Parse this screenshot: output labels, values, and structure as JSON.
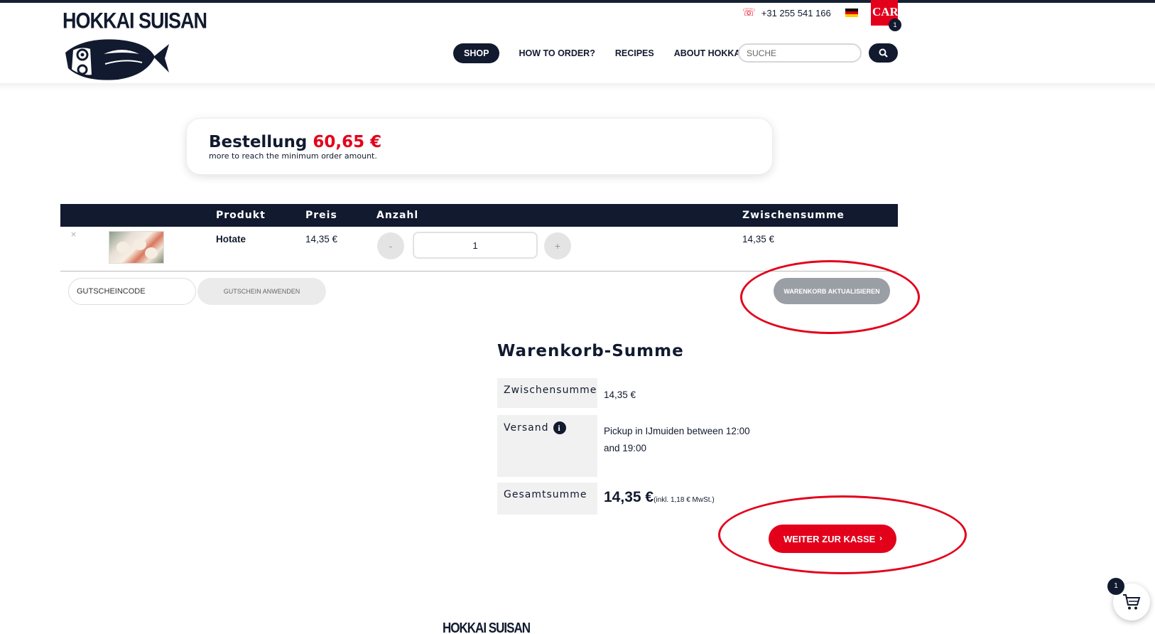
{
  "brand": {
    "name": "HOKKAI SUISAN"
  },
  "topbar": {
    "phone": "+31 255 541 166",
    "cart_label": "CART",
    "cart_count": "1"
  },
  "nav": {
    "items": [
      {
        "label": "SHOP",
        "active": true
      },
      {
        "label": "HOW TO ORDER?"
      },
      {
        "label": "RECIPES"
      },
      {
        "label": "ABOUT HOKKAI"
      }
    ],
    "search_placeholder": "SUCHE"
  },
  "notice": {
    "title": "Bestellung",
    "amount": "60,65 €",
    "subtitle": "more to reach the minimum order amount."
  },
  "cart_table": {
    "headers": {
      "product": "Produkt",
      "price": "Preis",
      "quantity": "Anzahl",
      "subtotal": "Zwischensumme"
    },
    "rows": [
      {
        "remove": "×",
        "name": "Hotate",
        "price": "14,35 €",
        "qty_minus": "-",
        "quantity": "1",
        "qty_plus": "+",
        "subtotal": "14,35 €"
      }
    ]
  },
  "coupon": {
    "placeholder": "GUTSCHEINCODE",
    "apply_label": "GUTSCHEIN ANWENDEN"
  },
  "update_cart_label": "WARENKORB AKTUALISIEREN",
  "totals": {
    "title": "Warenkorb-Summe",
    "subtotal_label": "Zwischensumme",
    "subtotal_value": "14,35 €",
    "shipping_label": "Versand",
    "shipping_value_line1": "Pickup in IJmuiden between 12:00",
    "shipping_value_line2": "and 19:00",
    "total_label": "Gesamtsumme",
    "total_value": "14,35 €",
    "tax_note": "(inkl. 1,18 € MwSt.)"
  },
  "checkout_label": "WEITER ZUR KASSE",
  "floating_cart_count": "1",
  "footer": {
    "logo_text": "HOKKAI SUISAN"
  },
  "colors": {
    "navy": "#111a2e",
    "red": "#e3001b",
    "annotation": "#e3001b"
  },
  "icons": [
    "phone-icon",
    "flag-de-icon",
    "search-icon",
    "remove-icon",
    "info-icon",
    "chevron-right-icon",
    "cart-icon"
  ]
}
